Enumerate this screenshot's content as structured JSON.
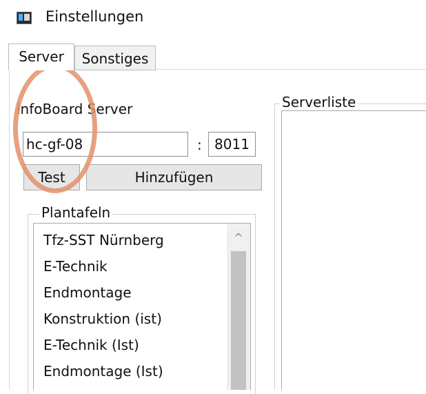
{
  "window": {
    "title": "Einstellungen",
    "icon": "settings-window-icon"
  },
  "tabs": [
    {
      "label": "Server",
      "active": true
    },
    {
      "label": "Sonstiges",
      "active": false
    }
  ],
  "server_panel": {
    "group_label": "infoBoard Server",
    "host_value": "hc-gf-08",
    "separator": ":",
    "port_value": "8011",
    "test_button": "Test",
    "add_button": "Hinzufügen"
  },
  "plantafeln": {
    "label": "Plantafeln",
    "items": [
      "Tfz-SST Nürnberg",
      "E-Technik",
      "Endmontage",
      "Konstruktion (ist)",
      "E-Technik (Ist)",
      "Endmontage (Ist)"
    ]
  },
  "serverliste": {
    "label": "Serverliste"
  },
  "colors": {
    "annotation_ring": "#e39068"
  }
}
